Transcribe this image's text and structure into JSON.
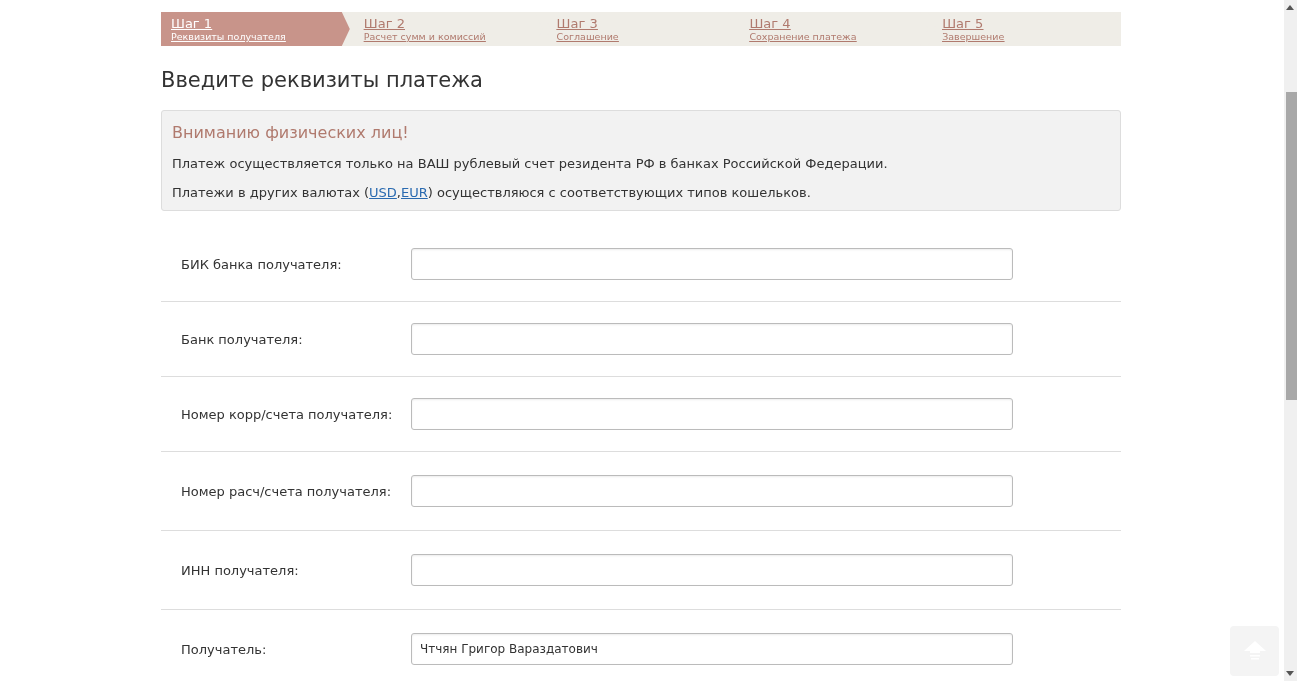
{
  "steps": [
    {
      "number": "Шаг 1",
      "label": "Реквизиты получателя",
      "selected": true
    },
    {
      "number": "Шаг 2",
      "label": "Расчет сумм и комиссий",
      "selected": false
    },
    {
      "number": "Шаг 3",
      "label": "Соглашение",
      "selected": false
    },
    {
      "number": "Шаг 4",
      "label": "Сохранение платежа",
      "selected": false
    },
    {
      "number": "Шаг 5",
      "label": "Завершение",
      "selected": false
    }
  ],
  "heading": "Введите реквизиты платежа",
  "notice": {
    "title": "Вниманию физических лиц!",
    "text": "Платеж осуществляется только на ВАШ рублевый счет резидента РФ в банках Российской Федерации.",
    "currency_line": {
      "text_before": "Платежи в других валютах (",
      "links": [
        "USD",
        "EUR"
      ],
      "separator": ",",
      "text_after": ") осуществляюся с соответствующих типов кошельков."
    }
  },
  "fields": [
    {
      "label": "БИК банка получателя:"
    },
    {
      "label": "Банк получателя:"
    },
    {
      "label": "Номер корр/счета получателя:"
    },
    {
      "label": "Номер расч/счета получателя:"
    },
    {
      "label": "ИНН получателя:"
    },
    {
      "label": "Получатель:",
      "value": "Чтчян Григор Вараздатович"
    }
  ]
}
